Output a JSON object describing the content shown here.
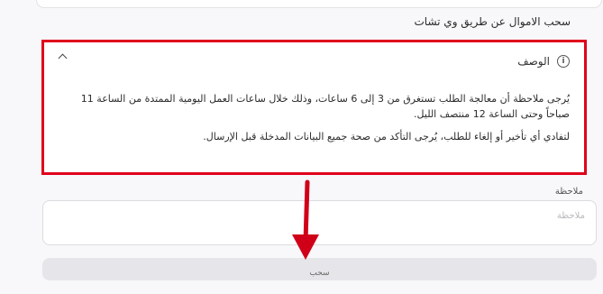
{
  "section_title": "سحب الاموال عن طريق وي تشات",
  "description": {
    "title": "الوصف",
    "line1": "يُرجى ملاحظة أن معالجة الطلب تستغرق من 3 إلى 6 ساعات، وذلك خلال ساعات العمل اليومية الممتدة من الساعة 11 صباحاً وحتى الساعة 12 منتصف الليل.",
    "line2": "لتفادي أي تأخير أو إلغاء للطلب، يُرجى التأكد من صحة جميع البيانات المدخلة قبل الإرسال."
  },
  "note": {
    "label": "ملاحظة",
    "placeholder": "ملاحظة",
    "value": ""
  },
  "submit_label": "سحب",
  "colors": {
    "highlight": "#e0001b",
    "button_bg": "#e6e6ea"
  },
  "icons": [
    "info-icon",
    "chevron-up-icon",
    "arrow-down-icon"
  ]
}
